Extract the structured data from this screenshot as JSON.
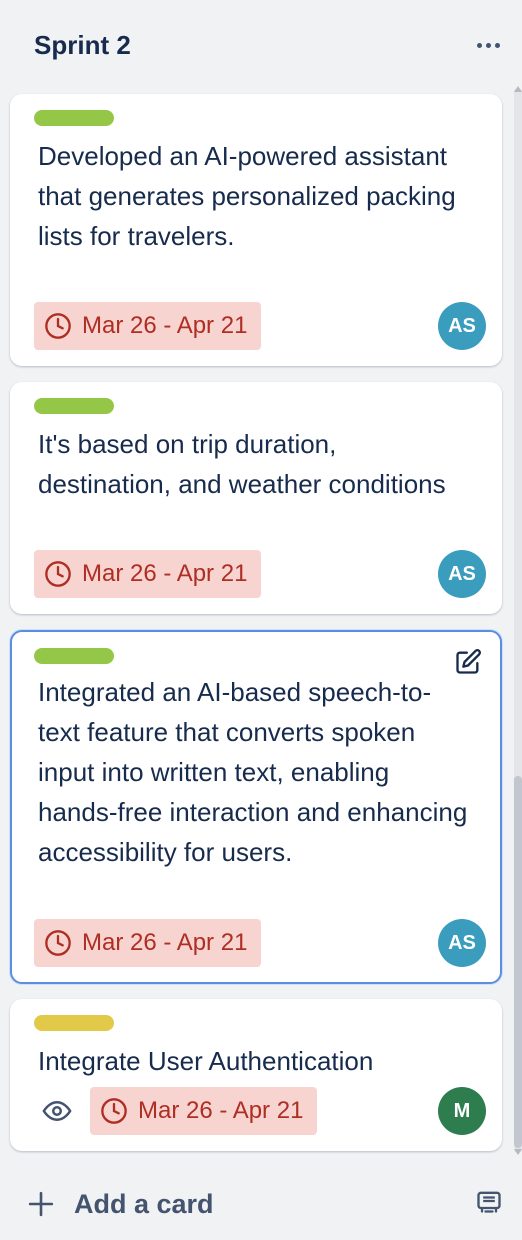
{
  "list": {
    "title": "Sprint 2",
    "more_icon": "ellipsis-icon"
  },
  "cards": [
    {
      "label_color": "#94c748",
      "title": "Developed an AI-powered assistant that generates personalized packing lists for travelers.",
      "dates": "Mar 26 - Apr 21",
      "member": {
        "initials": "AS",
        "color": "#3a9dbd"
      }
    },
    {
      "label_color": "#94c748",
      "title": "It's based on trip duration, destination, and weather conditions",
      "dates": "Mar 26 - Apr 21",
      "member": {
        "initials": "AS",
        "color": "#3a9dbd"
      }
    },
    {
      "label_color": "#94c748",
      "title": "Integrated an AI-based speech-to-text feature that converts spoken input into written text, enabling hands-free interaction and enhancing accessibility for users.",
      "dates": "Mar 26 - Apr 21",
      "member": {
        "initials": "AS",
        "color": "#3a9dbd"
      },
      "edit_icon": "pencil-square-icon"
    },
    {
      "label_color": "#e2c94a",
      "title": "Integrate User Authentication",
      "dates": "Mar 26 - Apr 21",
      "member": {
        "initials": "M",
        "color": "#2e7d4f"
      },
      "watch_icon": "eye-icon"
    }
  ],
  "footer": {
    "add_card_label": "Add a card",
    "add_icon": "plus-icon",
    "template_icon": "card-template-icon"
  },
  "colors": {
    "date_badge_bg": "#f8d4d0",
    "date_badge_text": "#ae2e24",
    "selected_border": "#5b8de0"
  }
}
